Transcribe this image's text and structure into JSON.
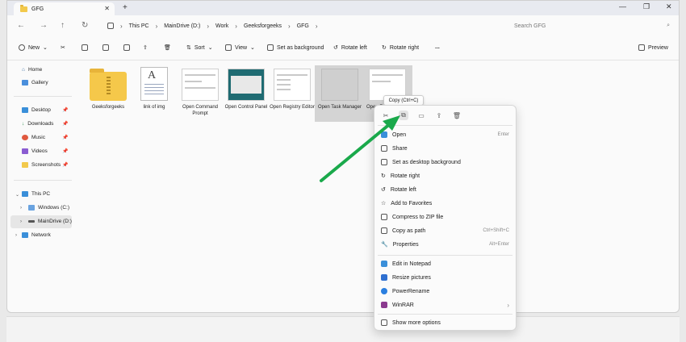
{
  "titlebar": {
    "tab_title": "GFG",
    "new_tab": "+",
    "close": "✕",
    "minimize": "—",
    "maximize": "❐",
    "win_close": "✕"
  },
  "address": {
    "crumbs": [
      "This PC",
      "MainDrive (D:)",
      "Work",
      "Geeksforgeeks",
      "GFG"
    ],
    "search_placeholder": "Search GFG"
  },
  "toolbar": {
    "new_label": "New",
    "sort_label": "Sort",
    "view_label": "View",
    "set_background_label": "Set as background",
    "rotate_left_label": "Rotate left",
    "rotate_right_label": "Rotate right",
    "more_label": "...",
    "preview_label": "Preview"
  },
  "sidebar": {
    "home": "Home",
    "gallery": "Gallery",
    "desktop": "Desktop",
    "downloads": "Downloads",
    "music": "Music",
    "videos": "Videos",
    "screenshots": "Screenshots",
    "this_pc": "This PC",
    "windows_c": "Windows (C:)",
    "maindrive_d": "MainDrive (D:)",
    "network": "Network"
  },
  "files": [
    {
      "label": "Geeksforgeeks"
    },
    {
      "label": "link of img"
    },
    {
      "label": "Open Command Prompt"
    },
    {
      "label": "Open Control Panel"
    },
    {
      "label": "Open Registry Editor"
    },
    {
      "label": "Open Task Manager"
    },
    {
      "label": "Open Ru"
    }
  ],
  "tooltip": "Copy (Ctrl+C)",
  "context_menu": {
    "open": "Open",
    "open_shortcut": "Enter",
    "share": "Share",
    "set_desktop_bg": "Set as desktop background",
    "rotate_right": "Rotate right",
    "rotate_left": "Rotate left",
    "add_favorites": "Add to Favorites",
    "compress_zip": "Compress to ZIP file",
    "copy_path": "Copy as path",
    "copy_path_shortcut": "Ctrl+Shift+C",
    "properties": "Properties",
    "properties_shortcut": "Alt+Enter",
    "edit_notepad": "Edit in Notepad",
    "resize_pictures": "Resize pictures",
    "power_rename": "PowerRename",
    "winrar": "WinRAR",
    "show_more": "Show more options"
  },
  "colors": {
    "accent": "#1aa94b",
    "folder": "#f2c94c",
    "selection": "#d4d4d4"
  }
}
